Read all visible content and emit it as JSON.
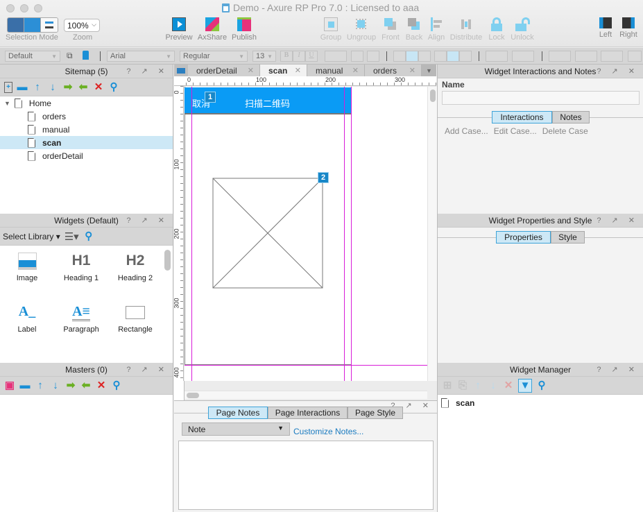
{
  "window": {
    "title": "Demo - Axure RP Pro 7.0 : Licensed to aaa"
  },
  "toolbar": {
    "selection_mode_label": "Selection Mode",
    "zoom_value": "100%",
    "zoom_label": "Zoom",
    "preview": "Preview",
    "axshare": "AxShare",
    "publish": "Publish",
    "group": "Group",
    "ungroup": "Ungroup",
    "front": "Front",
    "back": "Back",
    "align": "Align",
    "distribute": "Distribute",
    "lock": "Lock",
    "unlock": "Unlock",
    "left": "Left",
    "right": "Right"
  },
  "format": {
    "style": "Default",
    "font": "Arial",
    "weight": "Regular",
    "size": "13",
    "bold": "B",
    "italic": "I",
    "underline": "U"
  },
  "sitemap": {
    "title": "Sitemap (5)",
    "pages": [
      {
        "label": "Home",
        "level": 0
      },
      {
        "label": "orders",
        "level": 1
      },
      {
        "label": "manual",
        "level": 1
      },
      {
        "label": "scan",
        "level": 1,
        "selected": true
      },
      {
        "label": "orderDetail",
        "level": 1
      }
    ]
  },
  "widgets": {
    "title": "Widgets (Default)",
    "select_library": "Select Library",
    "items": [
      {
        "label": "Image",
        "icon": "image-icon"
      },
      {
        "label": "Heading 1",
        "icon": "H1"
      },
      {
        "label": "Heading 2",
        "icon": "H2"
      },
      {
        "label": "Label",
        "icon": "A_"
      },
      {
        "label": "Paragraph",
        "icon": "A≡"
      },
      {
        "label": "Rectangle",
        "icon": "rectangle-icon"
      }
    ]
  },
  "masters": {
    "title": "Masters (0)"
  },
  "canvas": {
    "tabs": [
      {
        "label": "orderDetail",
        "active": false
      },
      {
        "label": "scan",
        "active": true
      },
      {
        "label": "manual",
        "active": false
      },
      {
        "label": "orders",
        "active": false
      }
    ],
    "ruler_h": [
      "0",
      "100",
      "200",
      "300"
    ],
    "ruler_v": [
      "0",
      "100",
      "200",
      "300",
      "400"
    ],
    "header_left": "取消",
    "header_title": "扫描二维码",
    "badge_1": "1",
    "badge_2": "2",
    "accent": "#0a9bf5"
  },
  "notes_panel": {
    "tabs": [
      "Page Notes",
      "Page Interactions",
      "Page Style"
    ],
    "note_select": "Note",
    "customize": "Customize Notes..."
  },
  "interactions": {
    "title": "Widget Interactions and Notes",
    "name_label": "Name",
    "name_value": "",
    "tabs": [
      "Interactions",
      "Notes"
    ],
    "actions": [
      "Add Case...",
      "Edit Case...",
      "Delete Case"
    ]
  },
  "properties": {
    "title": "Widget Properties and Style",
    "tabs": [
      "Properties",
      "Style"
    ]
  },
  "manager": {
    "title": "Widget Manager",
    "items": [
      "scan"
    ]
  },
  "panel_controls": "? ↗ ✕"
}
